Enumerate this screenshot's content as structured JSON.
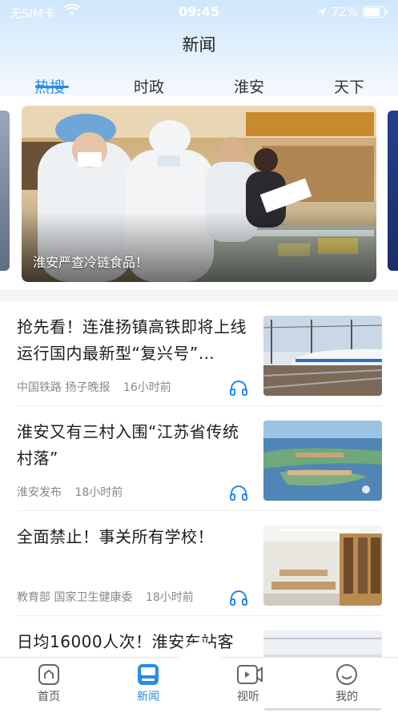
{
  "status_bar": {
    "carrier": "无SIM卡",
    "time": "09:45",
    "battery_text": "72%",
    "battery_level": 0.72
  },
  "header": {
    "title": "新闻"
  },
  "tabs": [
    {
      "label": "热搜",
      "active": true
    },
    {
      "label": "时政",
      "active": false
    },
    {
      "label": "淮安",
      "active": false
    },
    {
      "label": "天下",
      "active": false
    }
  ],
  "banner": {
    "caption": "淮安严查冷链食品！"
  },
  "feed": [
    {
      "title": "抢先看！连淮扬镇高铁即将上线运行国内最新型“复兴号”…",
      "sources": [
        "中国铁路 扬子晚报"
      ],
      "time": "16小时前",
      "thumb": "train"
    },
    {
      "title": "淮安又有三村入围“江苏省传统村落”",
      "sources": [
        "淮安发布"
      ],
      "time": "18小时前",
      "thumb": "village"
    },
    {
      "title": "全面禁止！事关所有学校！",
      "sources": [
        "教育部 国家卫生健康委"
      ],
      "time": "18小时前",
      "thumb": "library"
    },
    {
      "title": "日均16000人次！淮安东站客",
      "sources": [],
      "time": "",
      "thumb": "station"
    }
  ],
  "bottom_nav": [
    {
      "label": "首页",
      "icon": "home-icon",
      "active": false
    },
    {
      "label": "新闻",
      "icon": "news-icon",
      "active": true
    },
    {
      "label": "视听",
      "icon": "video-icon",
      "active": false
    },
    {
      "label": "我的",
      "icon": "profile-icon",
      "active": false
    }
  ],
  "colors": {
    "accent": "#2a8bea",
    "text": "#1d1d1d",
    "meta": "#888888"
  }
}
